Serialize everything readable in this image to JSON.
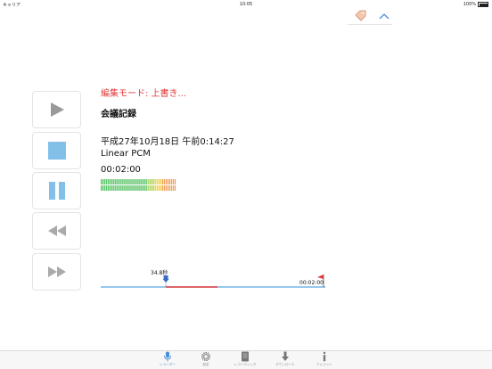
{
  "status": {
    "carrier": "キャリア",
    "time": "10:05",
    "battery": "100%"
  },
  "toolbar": {
    "tag_icon": "tag-icon",
    "collapse_icon": "chevron-up-icon"
  },
  "controls": {
    "play_icon": "play-icon",
    "record_icon": "stop-icon",
    "pause_icon": "pause-icon",
    "rewind_icon": "rewind-icon",
    "forward_icon": "fast-forward-icon"
  },
  "info": {
    "mode": "編集モード: 上書き...",
    "title": "会議記録",
    "datetime": "平成27年10月18日 午前0:14:27",
    "format": "Linear PCM",
    "duration": "00:02:00"
  },
  "meters": {
    "left_level": 1.0,
    "right_level": 1.0
  },
  "timeline": {
    "marker_time": "34.8秒",
    "end_time": "00:02:00",
    "playhead_fraction": 0.29,
    "edit_end_fraction": 0.52
  },
  "tabs": [
    {
      "label": "レコーダー",
      "icon": "microphone-icon",
      "active": true
    },
    {
      "label": "設定",
      "icon": "gear-icon",
      "active": false
    },
    {
      "label": "レコーディング",
      "icon": "recordings-list-icon",
      "active": false
    },
    {
      "label": "ダウンロード",
      "icon": "download-icon",
      "active": false
    },
    {
      "label": "クレジット",
      "icon": "info-icon",
      "active": false
    }
  ],
  "colors": {
    "accent": "#4a90d9",
    "button_blue": "#82c0ea",
    "edit_red": "#e03a3a",
    "meter_green": "#52c060"
  }
}
